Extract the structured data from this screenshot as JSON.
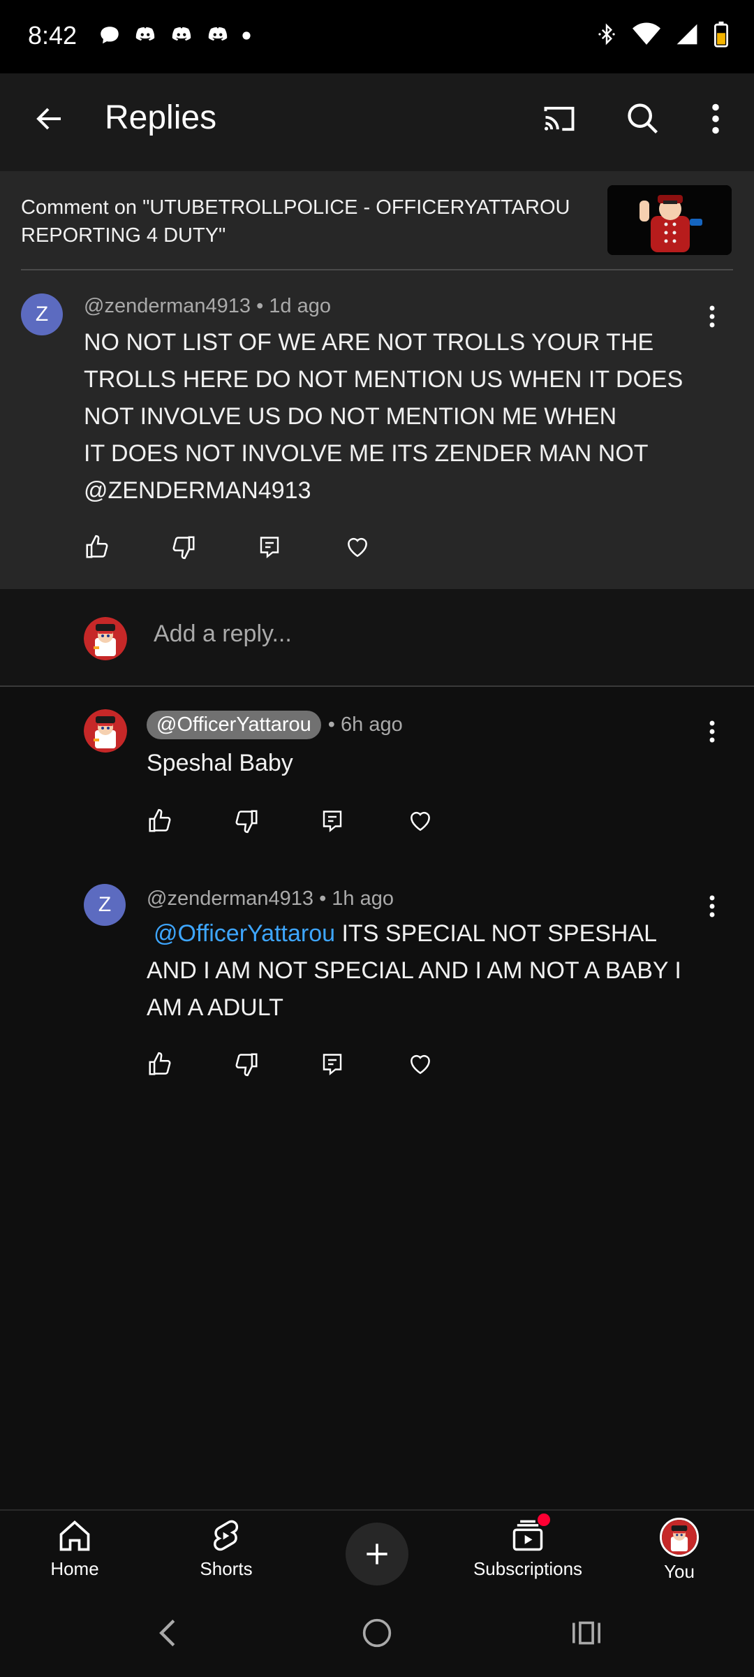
{
  "status_bar": {
    "time": "8:42"
  },
  "app_bar": {
    "title": "Replies"
  },
  "context": {
    "text": "Comment on \"UTUBETROLLPOLICE - OFFICERYATTAROU REPORTING 4 DUTY\""
  },
  "parent_comment": {
    "avatar_letter": "Z",
    "meta": "@zenderman4913 • 1d ago",
    "lines": [
      "NO NOT LIST OF WE ARE NOT TROLLS YOUR THE",
      "TROLLS HERE DO NOT MENTION US WHEN IT DOES",
      "NOT INVOLVE US DO NOT MENTION ME WHEN",
      "IT DOES NOT INVOLVE ME ITS ZENDER MAN NOT",
      "@ZENDERMAN4913"
    ]
  },
  "add_reply": {
    "placeholder": "Add a reply..."
  },
  "replies": [
    {
      "author_chip": "@OfficerYattarou",
      "time": "• 6h ago",
      "text": "Speshal Baby"
    },
    {
      "avatar_letter": "Z",
      "meta": "@zenderman4913 • 1h ago",
      "mention": "@OfficerYattarou",
      "line1": " ITS SPECIAL NOT SPESHAL",
      "line2": "AND I AM NOT SPECIAL AND I AM NOT A BABY I",
      "line3": "AM A ADULT"
    }
  ],
  "bottom_nav": {
    "home": "Home",
    "shorts": "Shorts",
    "subscriptions": "Subscriptions",
    "you": "You"
  },
  "colors": {
    "background": "#0f0f0f",
    "surface": "#272727",
    "link": "#3ea6ff",
    "avatar": "#5c6bc0",
    "notification_dot": "#ff0033"
  }
}
